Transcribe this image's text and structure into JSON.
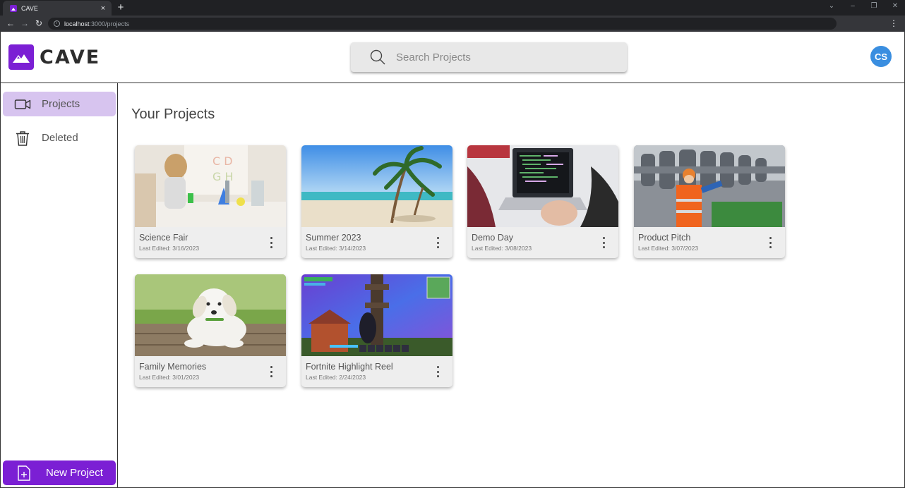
{
  "browser": {
    "tab_title": "CAVE",
    "tab_close": "×",
    "new_tab": "+",
    "url_host": "localhost",
    "url_path": ":3000/projects"
  },
  "header": {
    "logo_text": "CAVE",
    "search_placeholder": "Search Projects",
    "avatar_initials": "CS"
  },
  "sidebar": {
    "items": [
      {
        "label": "Projects",
        "icon": "video-camera-icon",
        "active": true
      },
      {
        "label": "Deleted",
        "icon": "trash-icon",
        "active": false
      }
    ],
    "new_project_label": "New Project"
  },
  "main": {
    "title": "Your Projects",
    "projects": [
      {
        "title": "Science Fair",
        "date": "Last Edited: 3/16/2023"
      },
      {
        "title": "Summer 2023",
        "date": "Last Edited: 3/14/2023"
      },
      {
        "title": "Demo Day",
        "date": "Last Edited: 3/08/2023"
      },
      {
        "title": "Product Pitch",
        "date": "Last Edited: 3/07/2023"
      },
      {
        "title": "Family Memories",
        "date": "Last Edited: 3/01/2023"
      },
      {
        "title": "Fortnite Highlight Reel",
        "date": "Last Edited: 2/24/2023"
      }
    ]
  },
  "colors": {
    "accent": "#7b1fd4",
    "active_nav": "#d7c4ef",
    "avatar": "#3a8ee0"
  }
}
